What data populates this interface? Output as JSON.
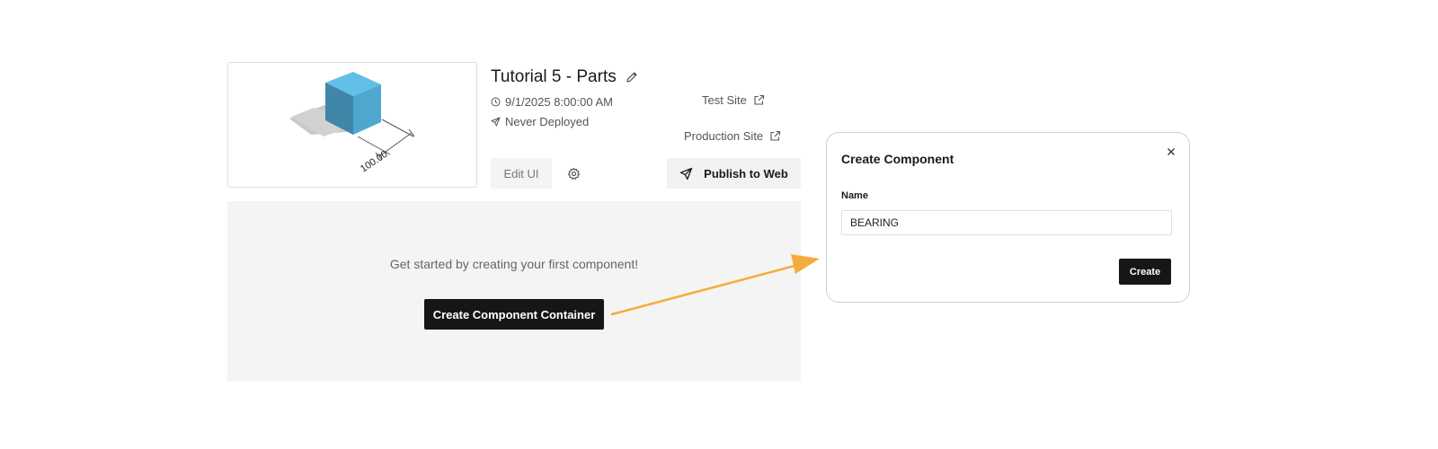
{
  "project": {
    "title": "Tutorial 5 - Parts",
    "date": "9/1/2025 8:00:00 AM",
    "deploy_status": "Never Deployed",
    "thumbnail_dimension": "100.00"
  },
  "links": {
    "test_site": "Test Site",
    "production_site": "Production Site"
  },
  "toolbar": {
    "edit_ui": "Edit UI",
    "publish": "Publish to Web"
  },
  "empty_state": {
    "message": "Get started by creating your first component!",
    "button": "Create Component Container"
  },
  "dialog": {
    "title": "Create Component",
    "name_label": "Name",
    "name_value": "BEARING",
    "create_button": "Create"
  },
  "icons": {
    "edit": "pencil-icon",
    "date": "clock-icon",
    "deploy": "send-icon",
    "external": "external-link-icon",
    "settings": "gear-icon",
    "publish": "send-icon",
    "close": "close-icon"
  },
  "colors": {
    "cube": "#5bbde6",
    "primary_button": "#161616",
    "annotation_arrow": "#f4ad3d",
    "panel_background": "#f4f4f4"
  }
}
